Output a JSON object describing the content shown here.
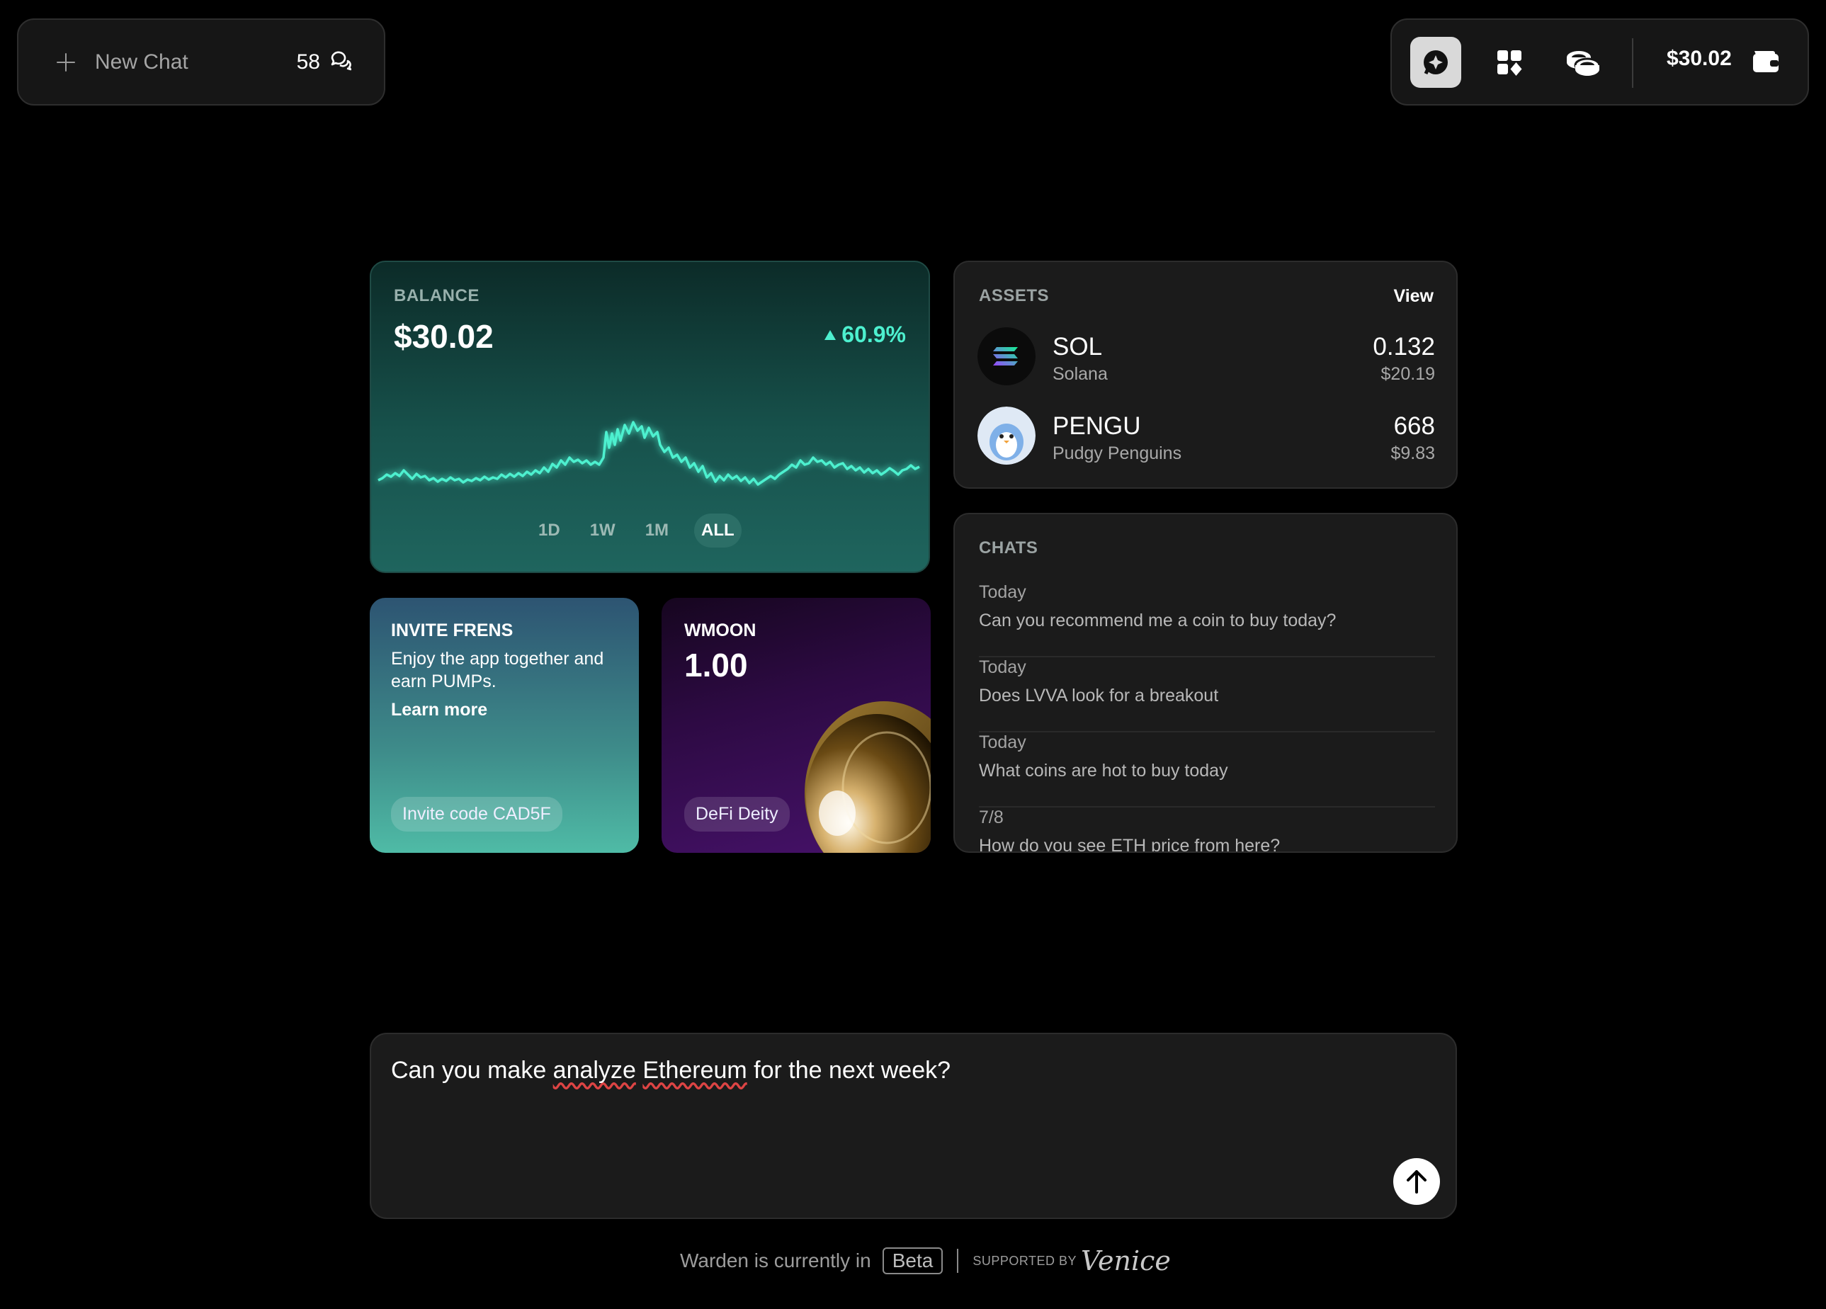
{
  "top_left": {
    "new_chat_label": "New Chat",
    "chat_count": "58"
  },
  "top_right": {
    "balance": "$30.02"
  },
  "balance_card": {
    "label": "BALANCE",
    "amount": "$30.02",
    "change": "60.9%",
    "ranges": [
      "1D",
      "1W",
      "1M",
      "ALL"
    ],
    "selected_range": "ALL",
    "accent_color": "#4df0cf"
  },
  "assets": {
    "label": "ASSETS",
    "view_label": "View",
    "items": [
      {
        "symbol": "SOL",
        "name": "Solana",
        "quantity": "0.132",
        "value": "$20.19"
      },
      {
        "symbol": "PENGU",
        "name": "Pudgy Penguins",
        "quantity": "668",
        "value": "$9.83"
      }
    ]
  },
  "chats": {
    "label": "CHATS",
    "items": [
      {
        "date": "Today",
        "title": "Can you recommend me a coin to buy today?"
      },
      {
        "date": "Today",
        "title": "Does LVVA look for a breakout"
      },
      {
        "date": "Today",
        "title": "What coins are hot to buy today"
      },
      {
        "date": "7/8",
        "title": "How do you see ETH price from here?"
      }
    ]
  },
  "invite": {
    "title": "INVITE FRENS",
    "description": "Enjoy the app together and earn PUMPs.",
    "learn_more": "Learn more",
    "code_label": "Invite code CAD5F"
  },
  "wmoon": {
    "title": "WMOON",
    "value": "1.00",
    "badge": "DeFi Deity"
  },
  "composer": {
    "text_1": "Can you make ",
    "text_2": "analyze",
    "text_3": " ",
    "text_4": "Ethereum",
    "text_5": " for the next week?"
  },
  "footer": {
    "text": "Warden is currently in",
    "beta": "Beta",
    "supported_by": "SUPPORTED BY",
    "brand": "Venice"
  }
}
